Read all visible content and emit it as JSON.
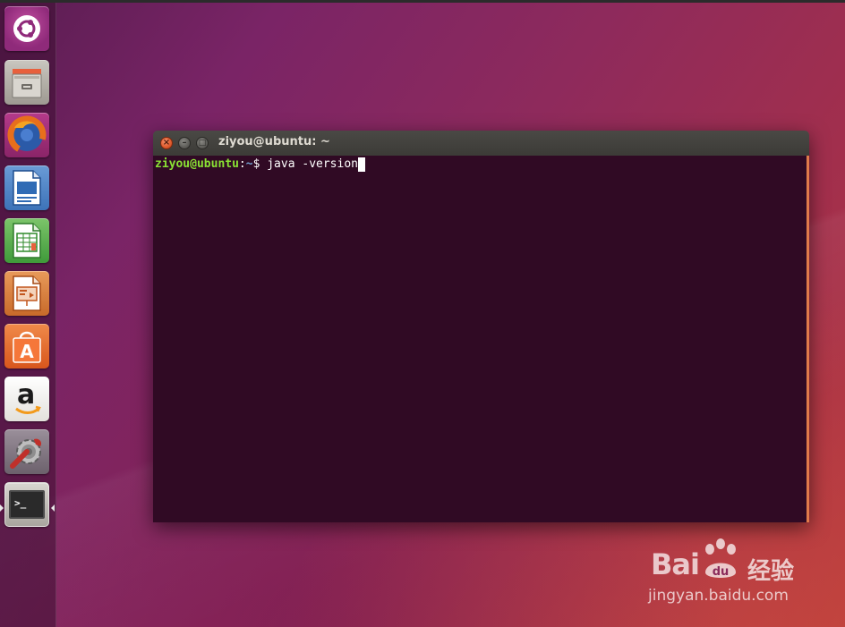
{
  "desktop": {
    "colors": {
      "background_start": "#5a1d52",
      "background_end": "#b83b3e",
      "launcher_bg": "#3c0e32"
    }
  },
  "launcher": {
    "items": [
      {
        "name": "dash-home",
        "icon": "ubuntu-logo-icon"
      },
      {
        "name": "files",
        "icon": "file-cabinet-icon"
      },
      {
        "name": "firefox",
        "icon": "firefox-icon"
      },
      {
        "name": "libreoffice-writer",
        "icon": "writer-document-icon"
      },
      {
        "name": "libreoffice-calc",
        "icon": "calc-spreadsheet-icon"
      },
      {
        "name": "libreoffice-impress",
        "icon": "impress-presentation-icon"
      },
      {
        "name": "ubuntu-software",
        "icon": "software-center-bag-icon"
      },
      {
        "name": "amazon",
        "icon": "amazon-logo-icon",
        "glyph": "a"
      },
      {
        "name": "system-settings",
        "icon": "wrench-gear-icon"
      },
      {
        "name": "terminal",
        "icon": "terminal-icon",
        "glyph": ">_",
        "active": true
      }
    ]
  },
  "terminal": {
    "title": "ziyou@ubuntu: ~",
    "close_glyph": "×",
    "min_glyph": "–",
    "max_glyph": "□",
    "prompt_user": "ziyou@ubuntu",
    "prompt_sep": ":",
    "prompt_path": "~",
    "prompt_symbol": "$ ",
    "command": "java -version",
    "colors": {
      "background": "#300a24",
      "titlebar": "#3c3b37",
      "user_green": "#8ae234",
      "path_blue": "#729fcf"
    }
  },
  "watermark": {
    "brand_latin": "Bai",
    "brand_du": "du",
    "brand_cn": "经验",
    "url": "jingyan.baidu.com"
  }
}
